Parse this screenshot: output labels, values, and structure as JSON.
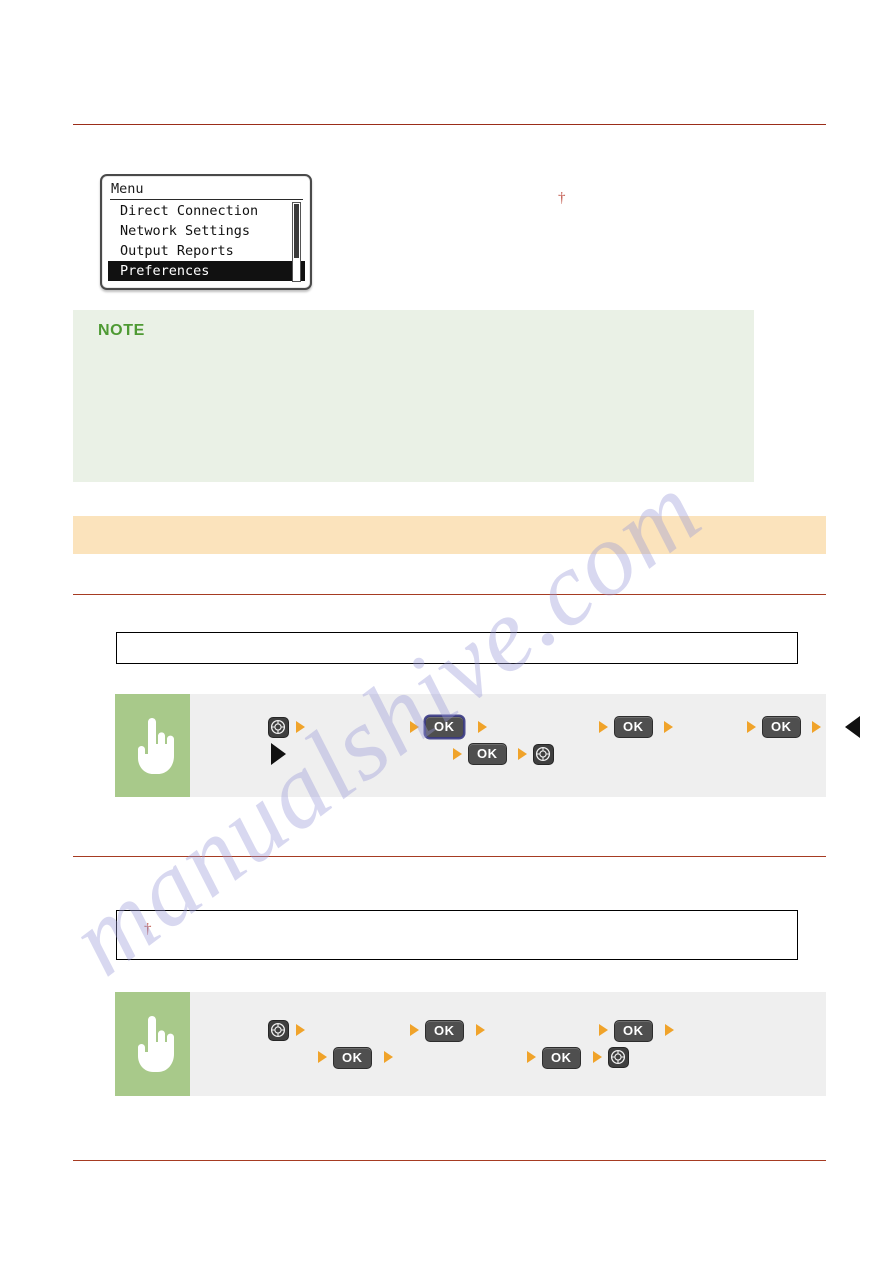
{
  "page": {
    "background": "#ffffff",
    "rule_color": "#9b2d19",
    "watermark_text": "manualshive.com"
  },
  "lcd": {
    "title": "Menu",
    "items": [
      {
        "label": "Direct Connection",
        "selected": false
      },
      {
        "label": "Network Settings",
        "selected": false
      },
      {
        "label": "Output Reports",
        "selected": false
      },
      {
        "label": "Preferences",
        "selected": true
      }
    ],
    "scrollbar": {
      "visible": true
    }
  },
  "footnote_marks": {
    "near_lcd": "†",
    "in_box": "†"
  },
  "note_box": {
    "label": "NOTE",
    "label_color": "#4e9a33",
    "background": "#eaf1e6",
    "body": ""
  },
  "banner": {
    "background": "#fbe3bc",
    "text": ""
  },
  "boxes": {
    "box_one_text": "",
    "box_two_text": ""
  },
  "flows": [
    {
      "name": "flow-one",
      "hand_icon": "pointing-hand-icon",
      "hand_background": "#a8c98a",
      "strip_background": "#efefef",
      "rows": [
        {
          "steps": [
            {
              "type": "key-menu",
              "label": "",
              "icon": "menu-key-icon"
            },
            {
              "type": "arrow-orange"
            },
            {
              "type": "arrow-orange"
            },
            {
              "type": "key-ok",
              "label": "OK",
              "highlight": true
            },
            {
              "type": "arrow-orange"
            },
            {
              "type": "arrow-orange"
            },
            {
              "type": "key-ok",
              "label": "OK",
              "highlight": false
            },
            {
              "type": "arrow-orange"
            },
            {
              "type": "arrow-orange"
            },
            {
              "type": "key-ok",
              "label": "OK",
              "highlight": false
            },
            {
              "type": "arrow-orange"
            },
            {
              "type": "arrow-black-left"
            }
          ]
        },
        {
          "steps": [
            {
              "type": "arrow-black-right"
            },
            {
              "type": "arrow-orange"
            },
            {
              "type": "key-ok",
              "label": "OK",
              "highlight": false
            },
            {
              "type": "arrow-orange"
            },
            {
              "type": "key-menu",
              "label": "",
              "icon": "menu-key-icon"
            }
          ]
        }
      ]
    },
    {
      "name": "flow-two",
      "hand_icon": "pointing-hand-icon",
      "hand_background": "#a8c98a",
      "strip_background": "#efefef",
      "rows": [
        {
          "steps": [
            {
              "type": "key-menu",
              "label": "",
              "icon": "menu-key-icon"
            },
            {
              "type": "arrow-orange"
            },
            {
              "type": "arrow-orange"
            },
            {
              "type": "key-ok",
              "label": "OK",
              "highlight": false
            },
            {
              "type": "arrow-orange"
            },
            {
              "type": "arrow-orange"
            },
            {
              "type": "key-ok",
              "label": "OK",
              "highlight": false
            },
            {
              "type": "arrow-orange"
            }
          ]
        },
        {
          "steps": [
            {
              "type": "arrow-orange"
            },
            {
              "type": "key-ok",
              "label": "OK",
              "highlight": false
            },
            {
              "type": "arrow-orange"
            },
            {
              "type": "arrow-orange"
            },
            {
              "type": "key-ok",
              "label": "OK",
              "highlight": false
            },
            {
              "type": "arrow-orange"
            },
            {
              "type": "key-menu",
              "label": "",
              "icon": "menu-key-icon"
            }
          ]
        }
      ]
    }
  ]
}
